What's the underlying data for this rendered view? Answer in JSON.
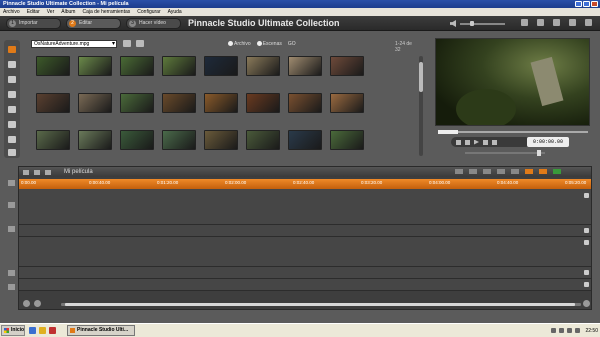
{
  "window": {
    "title": "Pinnacle Studio Ultimate Collection - Mi película"
  },
  "menu": [
    "Archivo",
    "Editar",
    "Ver",
    "Álbum",
    "Caja de herramientas",
    "Configurar",
    "Ayuda"
  ],
  "modes": [
    {
      "num": "1",
      "label": "Importar",
      "active": false
    },
    {
      "num": "2",
      "label": "Editar",
      "active": true
    },
    {
      "num": "3",
      "label": "Hacer vídeo",
      "active": false
    }
  ],
  "app_title": "Pinnacle Studio Ultimate Collection",
  "album": {
    "dropdown_value": "OsNatureAdventure.mpg",
    "radio_options": [
      "Archivo",
      "Escenas",
      "GO"
    ],
    "page_count": "1-24 de 32",
    "thumb_colors": [
      "#3d5a2a",
      "#6b8a4a",
      "#4a6b35",
      "#5e7a3c",
      "#1e2a3a",
      "#8a7a5a",
      "#a08c70",
      "#6e4a3a",
      "#5a4030",
      "#7a6a55",
      "#4a6a3a",
      "#6a4a2a",
      "#8a5a2a",
      "#6a3a20",
      "#7a5030",
      "#9a6a40",
      "#5a6a4a",
      "#6a7a5a",
      "#3a5a3a",
      "#4a6a4a",
      "#6a5a3a",
      "#4a5a3a",
      "#2a3a4a",
      "#4a6a3a"
    ]
  },
  "preview": {
    "timecode": "0:00:00.00"
  },
  "timeline": {
    "project_name": "Mi película",
    "ruler": [
      "0:00.00",
      "0:00:40.00",
      "0:01:20.00",
      "0:02:00.00",
      "0:02:40.00",
      "0:03:20.00",
      "0:04:00.00",
      "0:04:40.00",
      "0:05:20.00"
    ]
  },
  "taskbar": {
    "start_label": "Inicio",
    "task_label": "Pinnacle Studio Ulti...",
    "clock": "22:50"
  }
}
